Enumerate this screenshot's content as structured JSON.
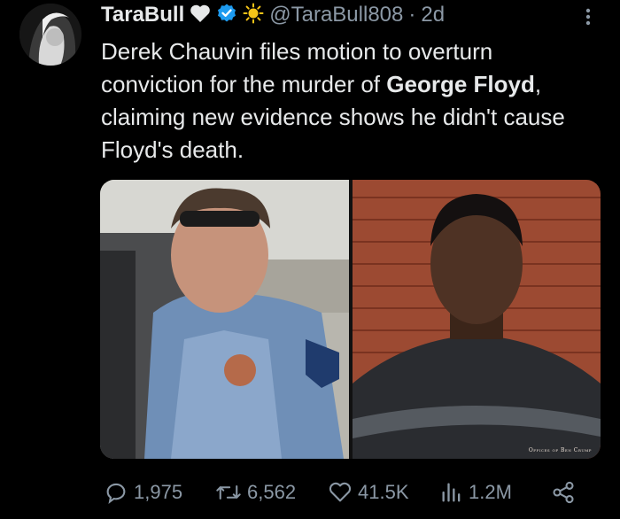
{
  "tweet": {
    "display_name": "TaraBull",
    "handle": "@TaraBull808",
    "separator": "·",
    "time": "2d",
    "text_before": "Derek Chauvin files motion to overturn conviction for the murder of ",
    "text_bold_1": "George Floyd",
    "text_after": ", claiming new evidence shows he didn't cause Floyd's death.",
    "media_credit": "Offices of Ben Crump"
  },
  "actions": {
    "replies": "1,975",
    "retweets": "6,562",
    "likes": "41.5K",
    "views": "1.2M"
  },
  "colors": {
    "background": "#000000",
    "text": "#e7e9ea",
    "muted": "#8b98a5",
    "verified": "#1d9bf0"
  },
  "icons": [
    "more-icon",
    "heart-icon",
    "verified-badge-icon",
    "sun-icon",
    "reply-icon",
    "retweet-icon",
    "like-icon",
    "views-icon",
    "share-icon"
  ]
}
